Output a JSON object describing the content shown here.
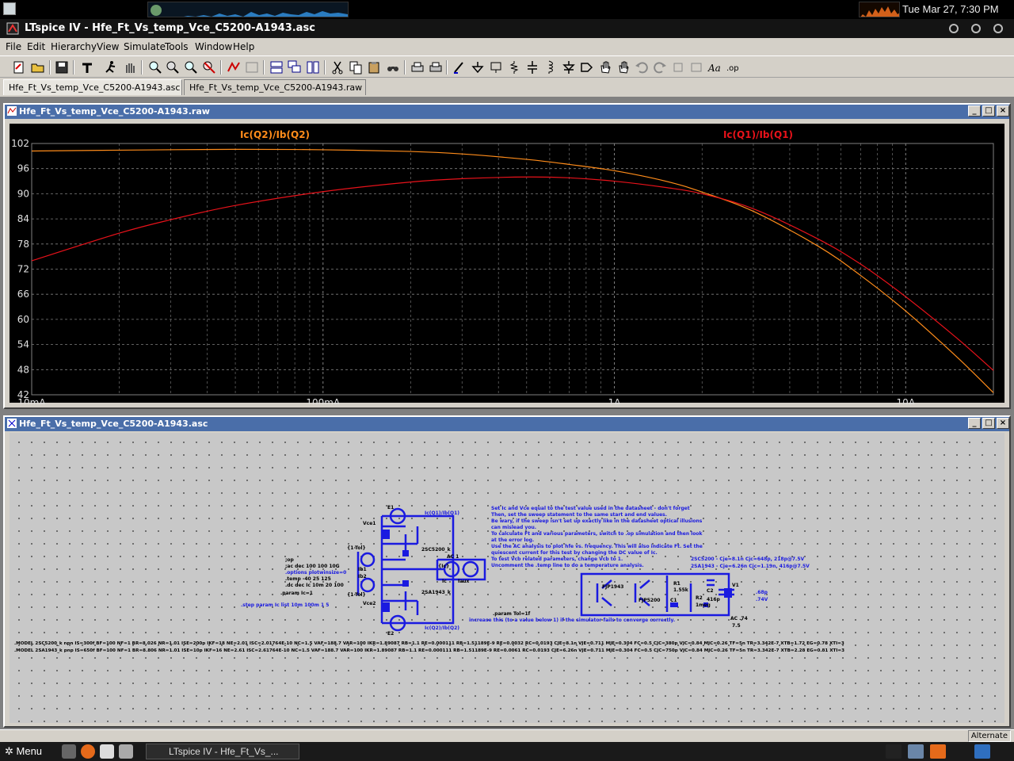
{
  "system_panel": {
    "clock": "Tue Mar 27,  7:30 PM"
  },
  "window": {
    "title": "LTspice IV - Hfe_Ft_Vs_temp_Vce_C5200-A1943.asc"
  },
  "menu": {
    "items": [
      "File",
      "Edit",
      "Hierarchy",
      "View",
      "Simulate",
      "Tools",
      "Window",
      "Help"
    ]
  },
  "tabs": [
    {
      "label": "Hfe_Ft_Vs_temp_Vce_C5200-A1943.asc",
      "active": true
    },
    {
      "label": "Hfe_Ft_Vs_temp_Vce_C5200-A1943.raw",
      "active": false
    }
  ],
  "plot_window": {
    "title": "Hfe_Ft_Vs_temp_Vce_C5200-A1943.raw",
    "controls": [
      "_",
      "□",
      "×"
    ]
  },
  "schematic_window": {
    "title": "Hfe_Ft_Vs_temp_Vce_C5200-A1943.asc",
    "controls": [
      "_",
      "□",
      "×"
    ]
  },
  "chart_data": {
    "type": "line",
    "title": "",
    "xscale": "log",
    "xlim": [
      0.01,
      20
    ],
    "ylim": [
      42,
      102
    ],
    "yticks": [
      102,
      96,
      90,
      84,
      78,
      72,
      66,
      60,
      54,
      48,
      42
    ],
    "xticks": [
      {
        "value": 0.01,
        "label": "10mA"
      },
      {
        "value": 0.1,
        "label": "100mA"
      },
      {
        "value": 1,
        "label": "1A"
      },
      {
        "value": 10,
        "label": "10A"
      }
    ],
    "series": [
      {
        "name": "Ic(Q2)/Ib(Q2)",
        "color": "#ff8c1a",
        "x": [
          0.01,
          0.02,
          0.05,
          0.1,
          0.2,
          0.3,
          0.5,
          0.7,
          1.0,
          1.5,
          2.0,
          3.0,
          5.0,
          7.0,
          10.0,
          15.0,
          20.0
        ],
        "y": [
          100.2,
          100.4,
          100.6,
          100.5,
          100.1,
          99.5,
          98.2,
          97.0,
          95.5,
          93.0,
          90.4,
          85.8,
          77.5,
          70.5,
          62.0,
          51.0,
          42.5
        ]
      },
      {
        "name": "Ic(Q1)/Ib(Q1)",
        "color": "#e8121a",
        "x": [
          0.01,
          0.02,
          0.03,
          0.05,
          0.1,
          0.2,
          0.3,
          0.5,
          0.7,
          1.0,
          1.5,
          2.0,
          3.0,
          5.0,
          7.0,
          10.0,
          15.0,
          20.0
        ],
        "y": [
          74.0,
          80.6,
          83.8,
          87.2,
          90.5,
          92.8,
          93.6,
          94.0,
          93.8,
          93.0,
          91.5,
          90.0,
          86.4,
          79.2,
          73.2,
          65.4,
          55.5,
          47.8
        ]
      }
    ]
  },
  "schematic": {
    "note_lines": [
      "Set Ic and Vce equal to the test value used in the datasheet - don't forget",
      "Then, set the sweep statement to the same start and end values.",
      "Be wary, if the sweep isn't set up exactly like in the datasheet optical illusions",
      "can mislead you.",
      "To calculate Ft and various parameters, switch to .op simulation and then look",
      "at the error log.",
      "Use the AC analysis to plot hfe vs. frequency. This will also indicate Ft. Set the",
      "quiescent current for this test by changing the DC value of Ic.",
      "To test Vcb related parameters, change Vcb to 1.",
      "Uncomment the .temp line to do a temperature analysis."
    ],
    "spice_directives": [
      ";op",
      ";ac dec 100 100 10G",
      ".options plotwinsize=0",
      ".temp -40 25 125",
      ".dc dec Ic 10m 20 100"
    ],
    "param_ic": ".param Ic=1",
    "step_param": ".step param Ic list 10m 100m 1 5",
    "param_tol": ".param Tol=1f",
    "tol_note": "increase this (to a value below 1) if the simulator fails to converge correctly.",
    "cap_notes": [
      "2SC5200 - Cje=8.1n Cjc=648p, 218p@7.5V",
      "2SA1943 - Cje=6.26n Cjc=1.19n, 416p@7.5V"
    ],
    "parts": {
      "q1": "2SC5200_k",
      "q2": "2SA1943_k",
      "q3": "FJP5200",
      "q4": "FJP1943",
      "e1": "E1",
      "e2": "E2",
      "vce1": "Vce1",
      "vce2": "Vce2",
      "ib1": "Ib1",
      "ib2": "Ib2",
      "ac1": "AC 1",
      "ac74": "AC .74",
      "v1": "V1",
      "v1_val": "7.5",
      "cap_vals": [
        ".68p",
        ".74V"
      ],
      "tol_labels": [
        "{1-Tol}",
        "{1-Tol}"
      ],
      "r_labels": [
        "R1",
        "1.55k",
        "R2",
        "1meg"
      ],
      "c_labels": [
        "C1",
        "C2",
        "416p"
      ],
      "mid_labels": [
        "{Ic}",
        "Iaux",
        "Ic"
      ],
      "probe_labels": [
        "Ic(Q1)/Ib(Q1)",
        "Ic(Q2)/Ib(Q2)"
      ]
    },
    "model_lines": [
      ".MODEL 2SC5200_k npn IS=300f BF=100 NF=1 BR=8.026 NR=1.01 ISE=200p IKF=18 NE=2.01 ISC=2.01764E-10 NC=1.5 VAF=188.7 VAR=100 IKR=1.89087 RB=1.1 RE=0.000111 RB=1.51189E-9 RE=0.0032 RC=0.0193 CJE=8.1n VJE=0.711 MJE=0.304 FC=0.5 CJC=380p VJC=0.84 MJC=0.26 TF=5n TR=3.342E-7 XTB=1.72 EG=0.78 XTI=3",
      ".MODEL 2SA1943_k pnp IS=650f BF=100 NF=1 BR=8.806 NR=1.01 ISE=10p IKF=16 NE=2.61 ISC=2.61764E-10 NC=1.5 VAF=188.7 VAR=100 IKR=1.89087 RB=1.1 RE=0.000111 RB=1.51189E-9 RE=0.0061 RC=0.0193 CJE=6.26n VJE=0.711 MJE=0.304 FC=0.5 CJC=750p VJC=0.84 MJC=0.26 TF=5n TR=3.342E-7 XTB=2.28 EG=0.81 XTI=3"
    ]
  },
  "statusbar": {
    "text": "Alternate"
  },
  "taskbar": {
    "menu_label": "Menu",
    "task_label": "LTspice IV - Hfe_Ft_Vs_..."
  },
  "colors": {
    "title_bg": "#4a6ea9",
    "plot_bg": "#000000",
    "grid": "#808080",
    "axis_text": "#e0e0e0",
    "schematic_blue": "#1a1ae0"
  }
}
